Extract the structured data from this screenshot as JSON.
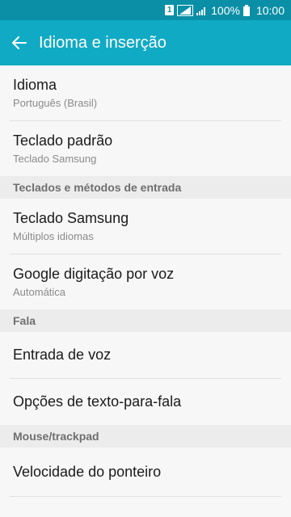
{
  "status_bar": {
    "sim_label": "1",
    "battery_percent": "100%",
    "time": "10:00"
  },
  "app_bar": {
    "title": "Idioma e inserção"
  },
  "items": {
    "idioma": {
      "title": "Idioma",
      "subtitle": "Português (Brasil)"
    },
    "teclado_padrao": {
      "title": "Teclado padrão",
      "subtitle": "Teclado Samsung"
    },
    "teclado_samsung": {
      "title": "Teclado Samsung",
      "subtitle": "Múltiplos idiomas"
    },
    "google_voz": {
      "title": "Google digitação por voz",
      "subtitle": "Automática"
    },
    "entrada_voz": {
      "title": "Entrada de voz"
    },
    "opcoes_tts": {
      "title": "Opções de texto-para-fala"
    },
    "velocidade_ponteiro": {
      "title": "Velocidade do ponteiro"
    }
  },
  "sections": {
    "teclados": "Teclados e métodos de entrada",
    "fala": "Fala",
    "mouse": "Mouse/trackpad"
  }
}
